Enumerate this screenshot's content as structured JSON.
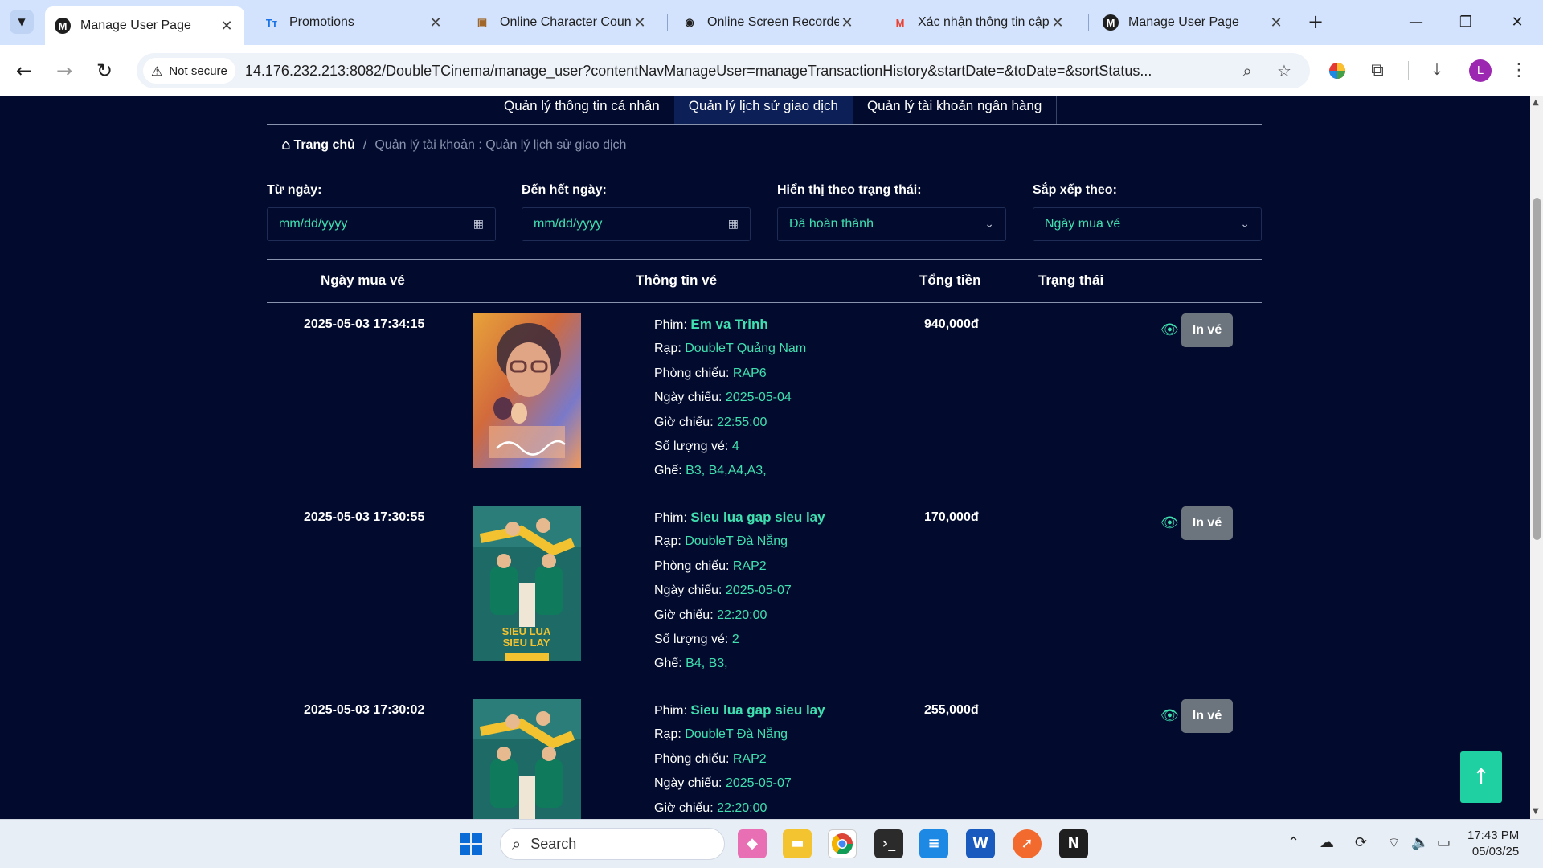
{
  "browser": {
    "tabs": [
      {
        "title": "Manage User Page",
        "favicon": "M",
        "icon": "site-logo-icon",
        "active": true
      },
      {
        "title": "Promotions",
        "favicon": "Tт",
        "icon": "tt-logo-icon",
        "active": false
      },
      {
        "title": "Online Character Count",
        "favicon": "▣",
        "icon": "box-icon",
        "active": false
      },
      {
        "title": "Online Screen Recorder",
        "favicon": "◉",
        "icon": "recorder-icon",
        "active": false
      },
      {
        "title": "Xác nhận thông tin cập",
        "favicon": "M",
        "icon": "gmail-icon",
        "active": false
      },
      {
        "title": "Manage User Page",
        "favicon": "M",
        "icon": "site-logo-icon",
        "active": false
      }
    ],
    "security_label": "Not secure",
    "url": "14.176.232.213:8082/DoubleTCinema/manage_user?contentNavManageUser=manageTransactionHistory&startDate=&toDate=&sortStatus...",
    "profile_initial": "L"
  },
  "subnav": {
    "items": [
      {
        "label": "Quản lý thông tin cá nhân",
        "active": false
      },
      {
        "label": "Quản lý lịch sử giao dịch",
        "active": true
      },
      {
        "label": "Quản lý tài khoản ngân hàng",
        "active": false
      }
    ]
  },
  "breadcrumb": {
    "home": "Trang chủ",
    "separator": "/",
    "current": "Quản lý tài khoản : Quản lý lịch sử giao dịch"
  },
  "filters": {
    "from_label": "Từ ngày:",
    "from_placeholder": "mm/dd/yyyy",
    "to_label": "Đến hết ngày:",
    "to_placeholder": "mm/dd/yyyy",
    "status_label": "Hiển thị theo trạng thái:",
    "status_value": "Đã hoàn thành",
    "sort_label": "Sắp xếp theo:",
    "sort_value": "Ngày mua vé"
  },
  "table": {
    "headers": {
      "date": "Ngày mua vé",
      "info": "Thông tin vé",
      "total": "Tổng tiền",
      "status": "Trạng thái"
    },
    "field_labels": {
      "movie": "Phim:",
      "cinema": "Rạp:",
      "room": "Phòng chiếu:",
      "show_date": "Ngày chiếu:",
      "show_time": "Giờ chiếu:",
      "quantity": "Số lượng vé:",
      "seats": "Ghế:"
    },
    "print_label": "In vé",
    "rows": [
      {
        "date": "2025-05-03  17:34:15",
        "poster": "em-va-trinh",
        "movie": "Em va Trinh",
        "cinema": "DoubleT Quảng Nam",
        "room": "RAP6",
        "show_date": "2025-05-04",
        "show_time": "22:55:00",
        "quantity": "4",
        "seats": "B3, B4,A4,A3,",
        "total": "940,000đ"
      },
      {
        "date": "2025-05-03  17:30:55",
        "poster": "sieu-lua-gap-sieu-lay",
        "movie": "Sieu lua gap sieu lay",
        "cinema": "DoubleT Đà Nẵng",
        "room": "RAP2",
        "show_date": "2025-05-07",
        "show_time": "22:20:00",
        "quantity": "2",
        "seats": "B4, B3,",
        "total": "170,000đ"
      },
      {
        "date": "2025-05-03  17:30:02",
        "poster": "sieu-lua-gap-sieu-lay",
        "movie": "Sieu lua gap sieu lay",
        "cinema": "DoubleT Đà Nẵng",
        "room": "RAP2",
        "show_date": "2025-05-07",
        "show_time": "22:20:00",
        "quantity": "",
        "seats": "",
        "total": "255,000đ"
      }
    ]
  },
  "taskbar": {
    "search_label": "Search",
    "time": "17:43 PM",
    "date": "05/03/25"
  },
  "colors": {
    "page_bg": "#020b2e",
    "accent": "#40e0b0",
    "print_button": "#6c757d",
    "scroll_top_button": "#1fd1a2"
  }
}
